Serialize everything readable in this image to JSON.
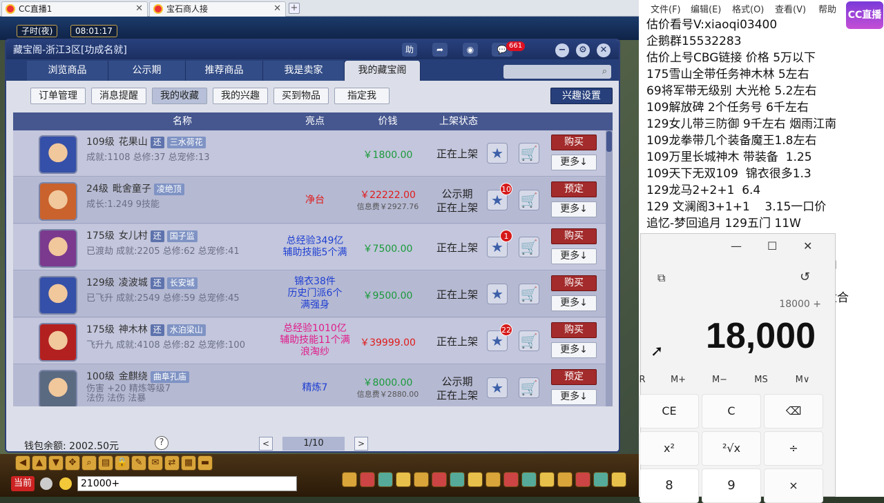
{
  "browser": {
    "tabs": [
      {
        "label": "CC直播1"
      },
      {
        "label": "宝石商人接"
      }
    ],
    "new_tab": "+"
  },
  "game": {
    "clock_prefix": "子时(夜)",
    "clock_time": "08:01:17",
    "chat_channel": "当前",
    "chat_input": "21000+"
  },
  "cbg": {
    "title": "藏宝阁-浙江3区[功成名就]",
    "title_help": "助",
    "msg_badge": "661",
    "nav_tabs": [
      "浏览商品",
      "公示期",
      "推荐商品",
      "我是卖家",
      "我的藏宝阁"
    ],
    "sub_tabs": [
      "订单管理",
      "消息提醒",
      "我的收藏",
      "我的兴趣",
      "买到物品",
      "指定我"
    ],
    "interest_settings": "兴趣设置",
    "columns": [
      "名称",
      "亮点",
      "价钱",
      "上架状态"
    ],
    "rows": [
      {
        "level": "109级",
        "school": "花果山",
        "huan": "还",
        "server": "三水荷花",
        "stats": "成就:1108 总修:37 总宠修:13",
        "highlight": "",
        "price": "￥1800.00",
        "price_color": "#1a9a3a",
        "fee": "",
        "status": "正在上架",
        "badge": "",
        "action": "购买",
        "more": "更多↓",
        "avatar_color": "#3550a8"
      },
      {
        "level": "24级",
        "school": "毗舍童子",
        "huan": "",
        "server": "凌绝顶",
        "stats": "成长:1.249 9技能",
        "highlight": "净台",
        "highlight_color": "#e01a1a",
        "price": "￥22222.00",
        "price_color": "#e01a1a",
        "fee": "信息费￥2927.76",
        "status": "公示期\n正在上架",
        "badge": "10",
        "action": "预定",
        "more": "更多↓",
        "avatar_color": "#c9622c"
      },
      {
        "level": "175级",
        "school": "女儿村",
        "huan": "还",
        "server": "国子监",
        "stats": "已渡劫 成就:2205 总修:62 总宠修:41",
        "highlight": "总经验349亿\n辅助技能5个满",
        "highlight_color": "#1f3fd1",
        "price": "￥7500.00",
        "price_color": "#1a9a3a",
        "fee": "",
        "status": "正在上架",
        "badge": "1",
        "action": "购买",
        "more": "更多↓",
        "avatar_color": "#7b3a8e"
      },
      {
        "level": "129级",
        "school": "凌波城",
        "huan": "还",
        "server": "长安城",
        "stats": "已飞升 成就:2549 总修:59 总宠修:45",
        "highlight": "锦衣38件\n历史门派6个\n满强身",
        "highlight_color": "#1f3fd1",
        "price": "￥9500.00",
        "price_color": "#1a9a3a",
        "fee": "",
        "status": "正在上架",
        "badge": "",
        "action": "购买",
        "more": "更多↓",
        "avatar_color": "#3550a8"
      },
      {
        "level": "175级",
        "school": "神木林",
        "huan": "还",
        "server": "水泊梁山",
        "stats": "飞升九 成就:4108 总修:82 总宠修:100",
        "highlight": "总经验1010亿\n辅助技能11个满\n浪淘纱",
        "highlight_color": "#e01a8a",
        "price": "￥39999.00",
        "price_color": "#e01a1a",
        "fee": "",
        "status": "正在上架",
        "badge": "22",
        "action": "购买",
        "more": "更多↓",
        "avatar_color": "#b32020"
      },
      {
        "level": "100级",
        "school": "金麒绕",
        "huan": "",
        "server": "曲阜孔庙",
        "stats": "伤害 +20 精炼等级7\n法伤 法伤 法暴",
        "highlight": "精炼7",
        "highlight_color": "#1f3fd1",
        "price": "￥8000.00",
        "price_color": "#1a9a3a",
        "fee": "信息费￥2880.00",
        "status": "公示期\n正在上架",
        "badge": "",
        "action": "预定",
        "more": "更多↓",
        "avatar_color": "#5a6a80"
      }
    ],
    "wallet": "钱包余额: 2002.50元",
    "help": "?",
    "page": "1/10",
    "prev": "<",
    "next": ">"
  },
  "notepad": {
    "menu": [
      "文件(F)",
      "编辑(E)",
      "格式(O)",
      "查看(V)",
      "帮助"
    ],
    "lines": [
      "估价看号V:xiaoqi03400",
      "企鹅群15532283",
      "估价上号CBG链接 价格 5万以下",
      "175雪山全带任务神木林 5左右",
      "69将军带无级别 大光枪 5.2左右",
      "109解放碑 2个任务号 6千左右",
      "129女儿带三防御 9千左右 烟雨江南",
      "109龙拳带几个装备魔王1.8左右",
      "109万里长城神木 带装备  1.25",
      "109天下无双109  锦衣很多1.3",
      "129龙马2+2+1  6.4",
      "129 文澜阁3+1+1    3.15一口价",
      "追忆-梦回追月 129五门 11W"
    ],
    "behind_text": [
      "内",
      "适合"
    ],
    "logo": "CC直播"
  },
  "calculator": {
    "expression": "18000 +",
    "display": "18,000",
    "memory": [
      "R",
      "M+",
      "M−",
      "MS",
      "M∨"
    ],
    "keys": [
      "CE",
      "C",
      "⌫",
      "x²",
      "²√x",
      "÷",
      "8",
      "9",
      "×"
    ]
  }
}
